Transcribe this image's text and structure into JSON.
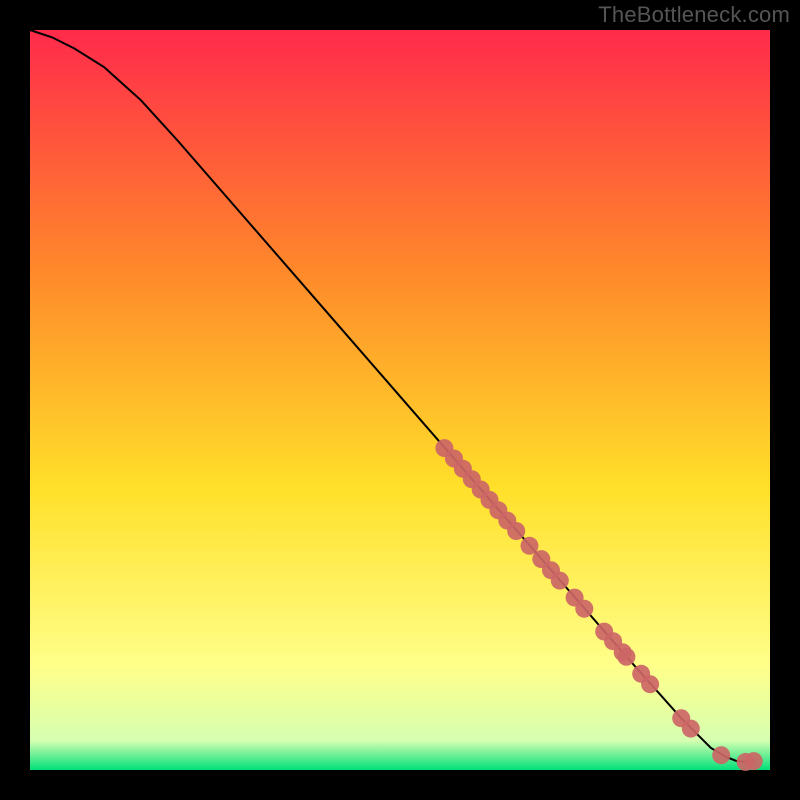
{
  "watermark": "TheBottleneck.com",
  "colors": {
    "gradient_top": "#ff2a4b",
    "gradient_mid_upper": "#ff8a2a",
    "gradient_mid": "#ffe02a",
    "gradient_lower": "#ffff8a",
    "gradient_bottom_band": "#00e07a",
    "line": "#000000",
    "point_fill": "#cc6666",
    "background": "#000000"
  },
  "chart_data": {
    "type": "line",
    "title": "",
    "xlabel": "",
    "ylabel": "",
    "xlim": [
      0,
      100
    ],
    "ylim": [
      0,
      100
    ],
    "curve": {
      "x": [
        0,
        3,
        6,
        10,
        15,
        20,
        30,
        40,
        50,
        60,
        70,
        80,
        88,
        92,
        94,
        95.5,
        97,
        98
      ],
      "y": [
        100,
        99,
        97.5,
        95,
        90.5,
        85,
        73.5,
        62,
        50.5,
        39,
        27.5,
        16,
        7,
        3,
        1.8,
        1.2,
        1.1,
        1.2
      ]
    },
    "series": [
      {
        "name": "points",
        "x": [
          56,
          57.3,
          58.5,
          59.7,
          60.9,
          62.1,
          63.3,
          64.5,
          65.7,
          67.5,
          69.1,
          70.4,
          71.6,
          73.6,
          74.9,
          77.6,
          78.8,
          80.1,
          80.6,
          82.6,
          83.8,
          88.0,
          89.3,
          93.4,
          96.7,
          97.8
        ],
        "y": [
          43.5,
          42.1,
          40.7,
          39.3,
          37.9,
          36.5,
          35.1,
          33.7,
          32.3,
          30.3,
          28.5,
          27.0,
          25.6,
          23.3,
          21.8,
          18.7,
          17.4,
          15.9,
          15.3,
          13.0,
          11.6,
          7.0,
          5.6,
          2.0,
          1.1,
          1.2
        ]
      }
    ]
  }
}
